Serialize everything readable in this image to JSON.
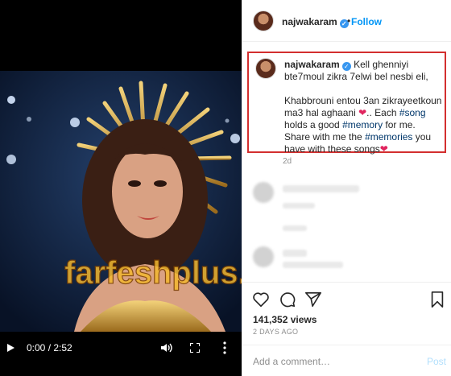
{
  "video": {
    "time": "0:00 / 2:52",
    "watermark": "farfeshplus.com",
    "icons": {
      "play": "play-icon",
      "volume": "volume-icon",
      "fullscreen": "fullscreen-icon",
      "more": "more-vertical-icon"
    }
  },
  "post": {
    "username": "najwakaram",
    "follow_sep": "•",
    "follow_label": "Follow",
    "caption": {
      "username": "najwakaram",
      "line1": "Kell ghenniyi bte7moul zikra 7elwi bel nesbi eli,",
      "line2_a": "Khabbrouni entou 3an zikrayeetkoun ma3 hal aghaani ",
      "line2_b": ".. Each ",
      "tag_song": "#song",
      "line2_c": " holds a good ",
      "tag_memory": "#memory",
      "line2_d": " for me.",
      "line3_a": "Share with me the ",
      "tag_memories": "#memories",
      "line3_b": " you have with these songs",
      "heart": "❤"
    },
    "age": "2d",
    "views": "141,352 views",
    "date": "2 DAYS AGO",
    "comment_placeholder": "Add a comment…",
    "post_label": "Post",
    "colors": {
      "accent": "#0095f6",
      "highlight_border": "#d32f2f",
      "heart": "#e0245e",
      "hashtag": "#00376b"
    }
  }
}
